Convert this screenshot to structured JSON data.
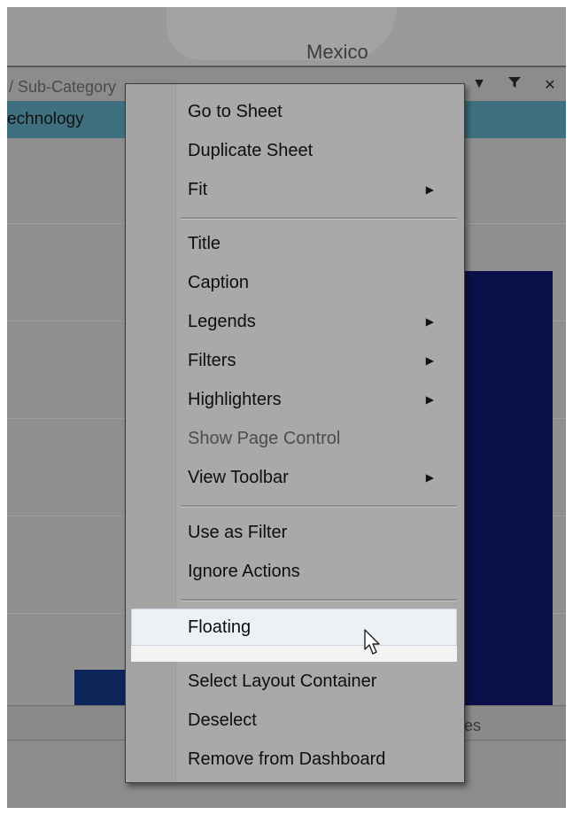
{
  "background": {
    "map_label": "Mexico",
    "sheet_header_title": "/ Sub-Category",
    "category_label": "echnology",
    "axis_partial_label": "es",
    "header_icons": [
      "dropdown-arrow-icon",
      "filter-funnel-icon",
      "close-icon"
    ]
  },
  "context_menu": {
    "go_to_sheet": "Go to Sheet",
    "duplicate_sheet": "Duplicate Sheet",
    "fit": "Fit",
    "title": "Title",
    "caption": "Caption",
    "legends": "Legends",
    "filters": "Filters",
    "highlighters": "Highlighters",
    "show_page_control": "Show Page Control",
    "view_toolbar": "View Toolbar",
    "use_as_filter": "Use as Filter",
    "ignore_actions": "Ignore Actions",
    "floating": "Floating",
    "select_layout_container": "Select Layout Container",
    "deselect": "Deselect",
    "remove_from_dashboard": "Remove from Dashboard",
    "submenu_arrow": "▶"
  },
  "colors": {
    "menu_background": "#a9a9a9",
    "highlight": "#edf1f6",
    "category_bar": "#3f7080",
    "bar_dark": "#0b0f4a"
  }
}
